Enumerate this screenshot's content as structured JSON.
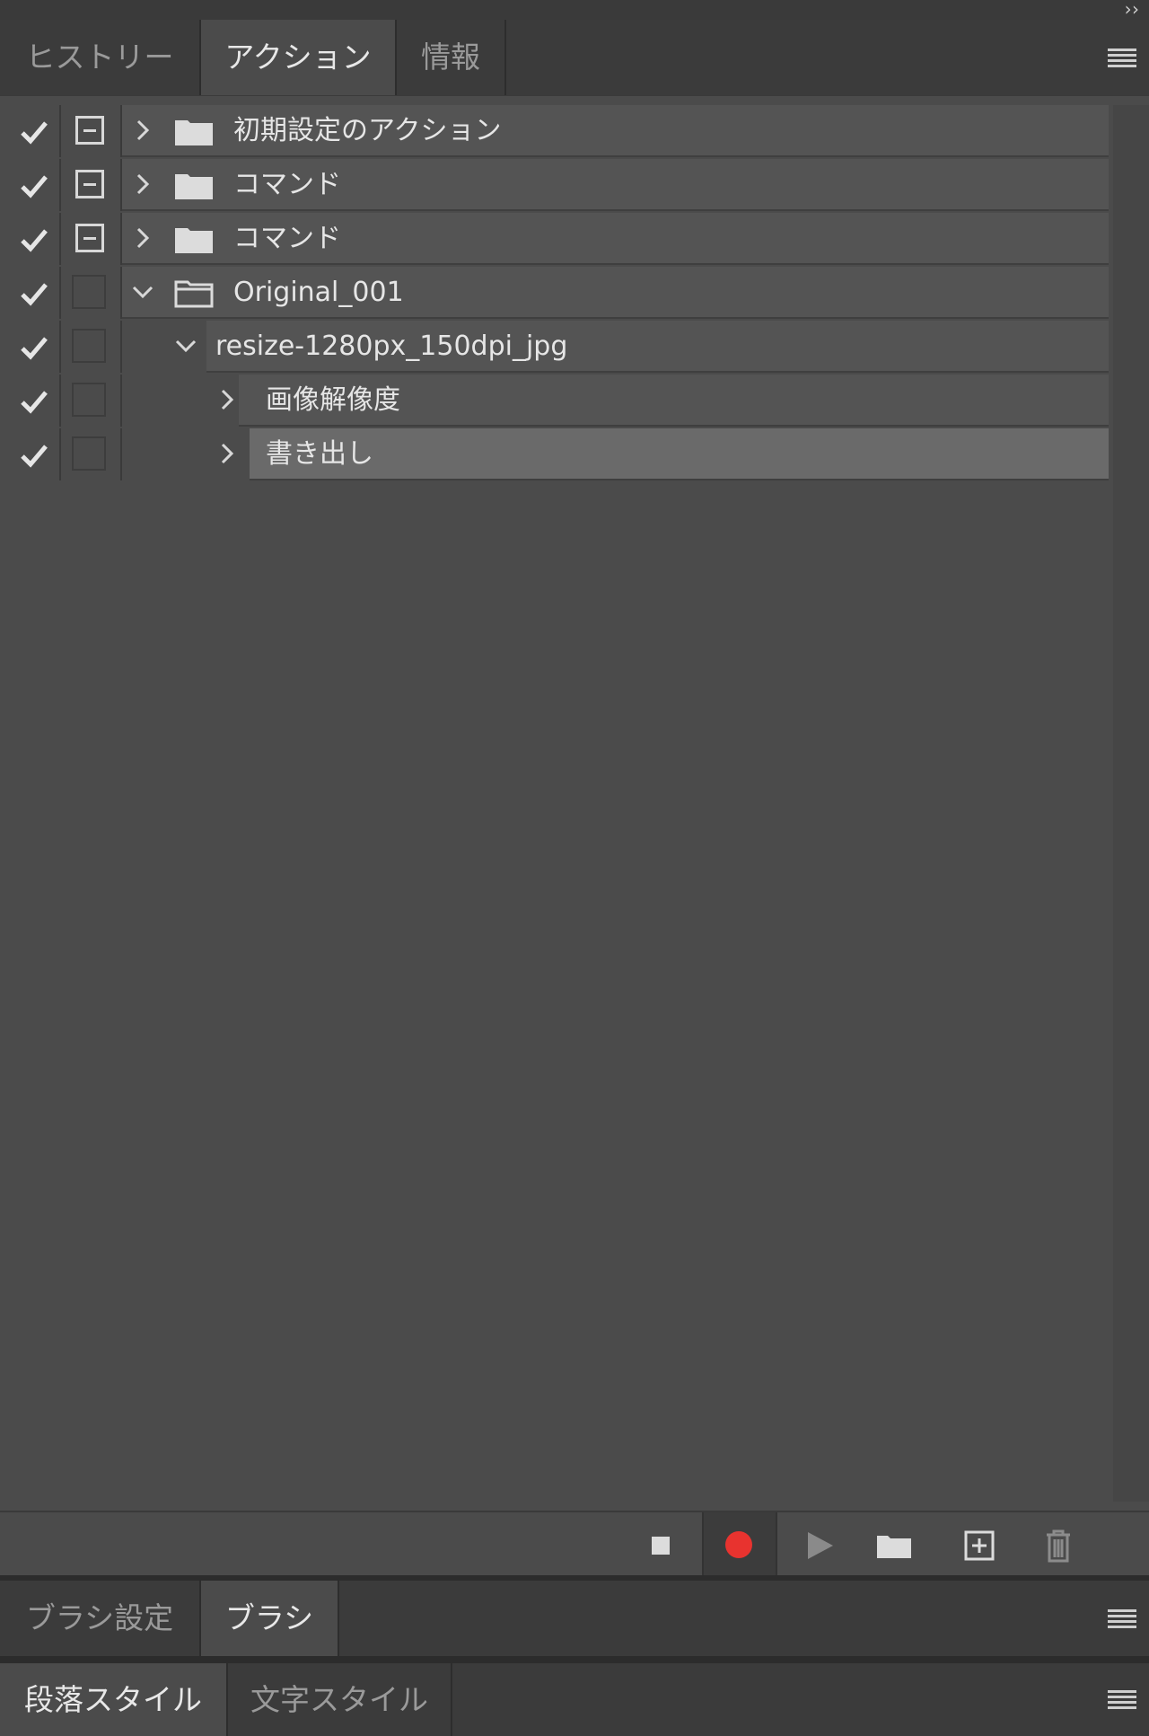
{
  "top_panel": {
    "tabs": [
      {
        "label": "ヒストリー",
        "active": false
      },
      {
        "label": "アクション",
        "active": true
      },
      {
        "label": "情報",
        "active": false
      }
    ]
  },
  "actions": {
    "rows": [
      {
        "label": "初期設定のアクション",
        "checked": true,
        "dialog": true,
        "expanded": false,
        "type": "set"
      },
      {
        "label": "コマンド",
        "checked": true,
        "dialog": true,
        "expanded": false,
        "type": "set"
      },
      {
        "label": "コマンド",
        "checked": true,
        "dialog": true,
        "expanded": false,
        "type": "set"
      },
      {
        "label": "Original_001",
        "checked": true,
        "dialog": false,
        "expanded": true,
        "type": "set"
      },
      {
        "label": "resize-1280px_150dpi_jpg",
        "checked": true,
        "dialog": false,
        "expanded": true,
        "type": "action"
      },
      {
        "label": "画像解像度",
        "checked": true,
        "dialog": false,
        "expanded": false,
        "type": "command"
      },
      {
        "label": "書き出し",
        "checked": true,
        "dialog": false,
        "expanded": false,
        "type": "command",
        "selected": true
      }
    ]
  },
  "toolbar": {
    "buttons": [
      "stop-icon",
      "record-icon",
      "play-icon",
      "new-set-icon",
      "new-action-icon",
      "trash-icon"
    ],
    "record_color": "#e8332f"
  },
  "brush_panel": {
    "tabs": [
      {
        "label": "ブラシ設定",
        "active": false
      },
      {
        "label": "ブラシ",
        "active": true
      }
    ]
  },
  "style_panel": {
    "tabs": [
      {
        "label": "段落スタイル",
        "active": true
      },
      {
        "label": "文字スタイル",
        "active": false
      }
    ]
  }
}
